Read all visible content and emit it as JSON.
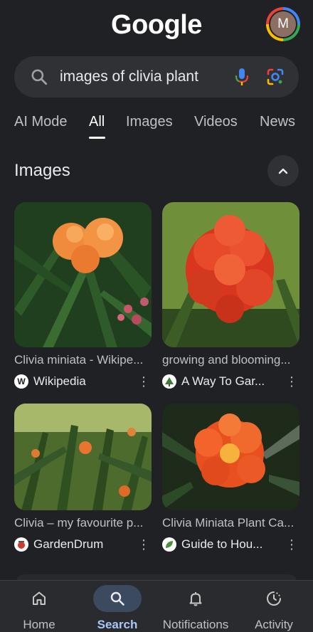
{
  "header": {
    "logo": "Google",
    "avatar_initial": "M"
  },
  "search": {
    "query": "images of clivia plant",
    "icons": [
      "search-icon",
      "mic-icon",
      "google-lens-icon"
    ]
  },
  "tabs": [
    {
      "label": "AI Mode",
      "active": false
    },
    {
      "label": "All",
      "active": true
    },
    {
      "label": "Images",
      "active": false
    },
    {
      "label": "Videos",
      "active": false
    },
    {
      "label": "News",
      "active": false
    }
  ],
  "images_section": {
    "title": "Images",
    "collapse_icon": "chevron-up-icon",
    "results": [
      {
        "caption": "Clivia miniata - Wikipe...",
        "source": "Wikipedia",
        "favicon": "W"
      },
      {
        "caption": "growing and blooming...",
        "source": "A Way To Gar...",
        "favicon": "tree"
      },
      {
        "caption": "Clivia – my favourite p...",
        "source": "GardenDrum",
        "favicon": "drum"
      },
      {
        "caption": "Clivia Miniata Plant Ca...",
        "source": "Guide to Hou...",
        "favicon": "leaf"
      }
    ]
  },
  "bottom_nav": [
    {
      "label": "Home",
      "icon": "home-icon",
      "active": false
    },
    {
      "label": "Search",
      "icon": "search-icon",
      "active": true
    },
    {
      "label": "Notifications",
      "icon": "bell-icon",
      "active": false
    },
    {
      "label": "Activity",
      "icon": "activity-icon",
      "active": false
    }
  ],
  "colors": {
    "background": "#202124",
    "search_bar": "#303134",
    "active_nav": "#a8c7fa"
  }
}
